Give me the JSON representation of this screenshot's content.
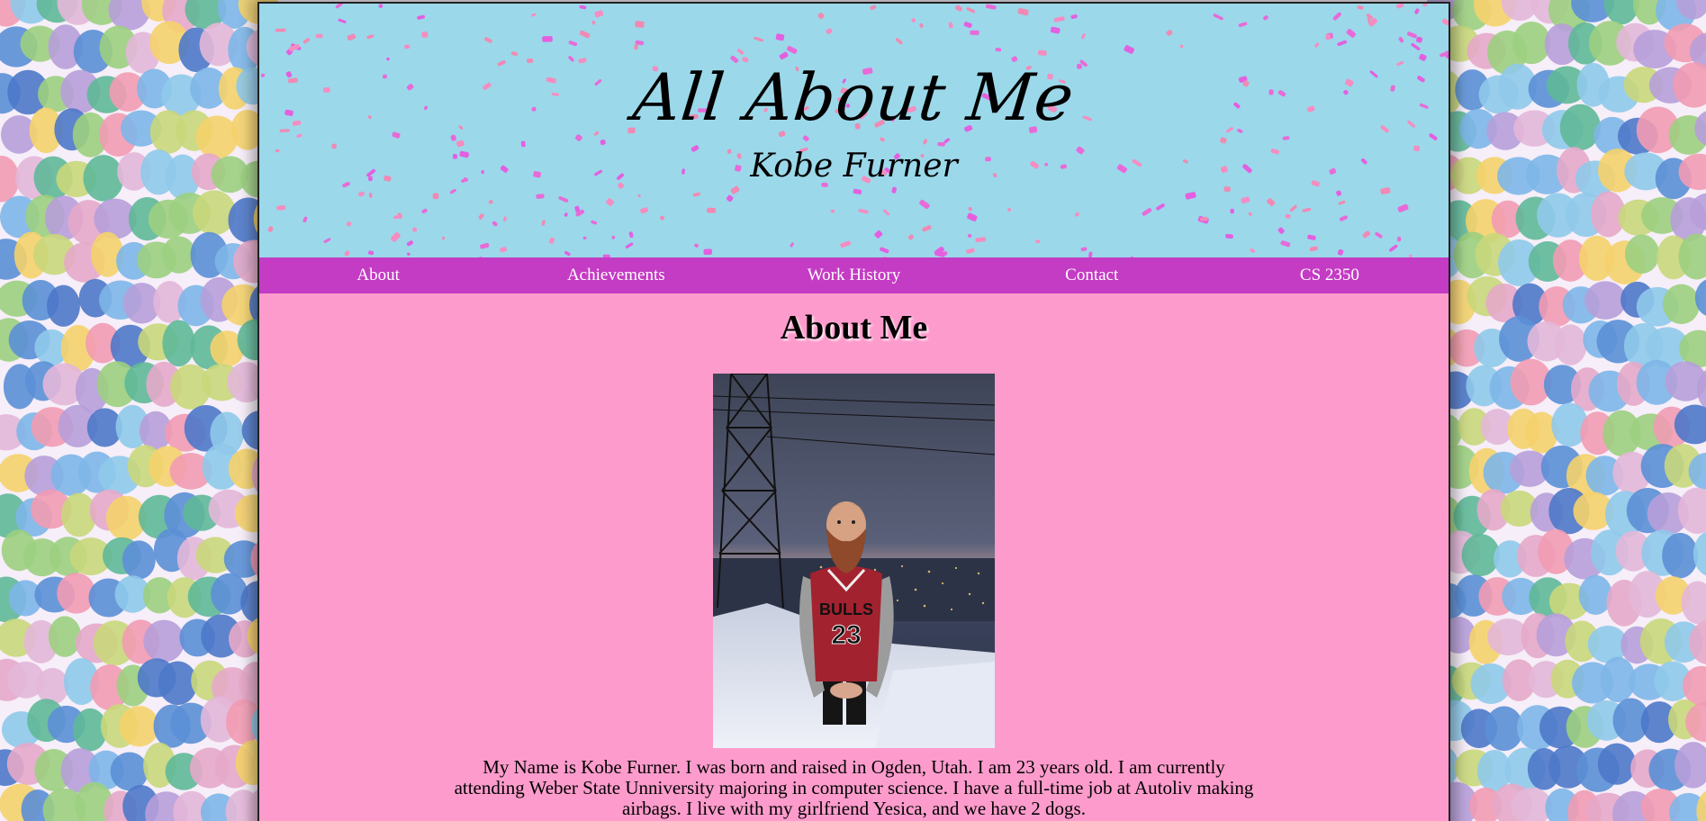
{
  "site": {
    "title": "All About Me",
    "subtitle": "Kobe Furner"
  },
  "nav": {
    "items": [
      {
        "label": "About"
      },
      {
        "label": "Achievements"
      },
      {
        "label": "Work History"
      },
      {
        "label": "Contact"
      },
      {
        "label": "CS 2350"
      }
    ]
  },
  "main": {
    "section_title": "About Me",
    "photo": {
      "alt": "photo"
    },
    "bio": "My Name is Kobe Furner. I was born and raised in Ogden, Utah. I am 23 years old. I am currently attending Weber State Unniversity majoring in computer science. I have a full-time job at Autoliv making airbags. I live with my girlfriend Yesica, and we have 2 dogs."
  },
  "colors": {
    "header_bg": "#9bd8ea",
    "nav_bg": "#c43bc4",
    "content_bg": "#fd9ccc",
    "nav_text": "#ffffff"
  }
}
